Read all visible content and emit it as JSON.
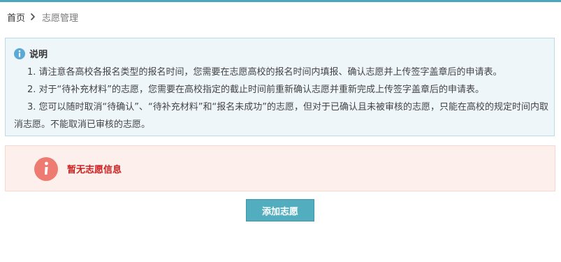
{
  "breadcrumb": {
    "home": "首页",
    "current": "志愿管理"
  },
  "info": {
    "title": "说明",
    "lines": [
      "1. 请注意各高校各报名类型的报名时间，您需要在志愿高校的报名时间内填报、确认志愿并上传签字盖章后的申请表。",
      "2. 对于“待补充材料”的志愿，您需要在高校指定的截止时间前重新确认志愿并重新完成上传签字盖章后的申请表。",
      "3. 您可以随时取消“待确认”、“待补充材料”和“报名未成功”的志愿，但对于已确认且未被审核的志愿，只能在高校的规定时间内取消志愿。不能取消已审核的志愿。"
    ]
  },
  "alert": {
    "message": "暂无志愿信息"
  },
  "actions": {
    "add_label": "添加志愿"
  },
  "colors": {
    "accent": "#4aa6bf",
    "button": "#52aebf",
    "info_bg": "#eef6fa",
    "info_border": "#b8dde9",
    "alert_bg": "#fdf0ec",
    "alert_icon": "#ee7b72",
    "alert_text": "#cc1f1f"
  },
  "icons": {
    "breadcrumb_separator": "chevron-right-icon",
    "info": "info-icon",
    "alert": "alert-info-icon"
  }
}
